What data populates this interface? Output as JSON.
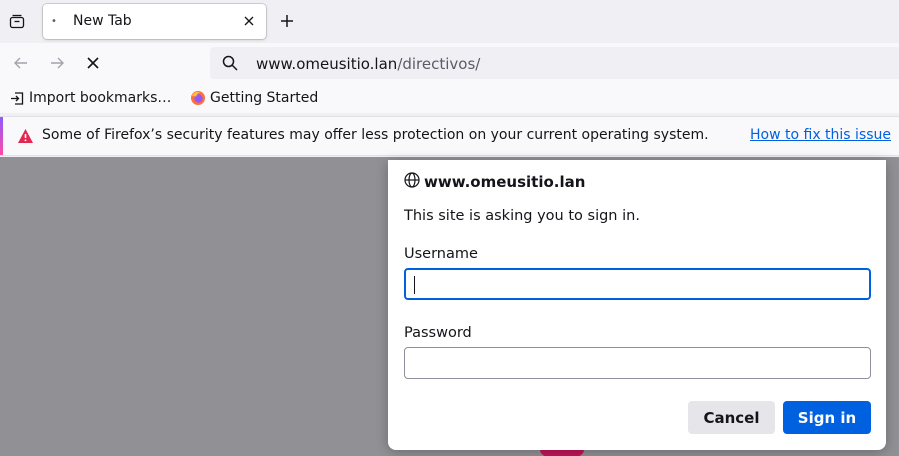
{
  "tabs": [
    {
      "title": "New Tab",
      "active": true
    }
  ],
  "toolbar": {
    "url_host": "www.omeusitio.lan",
    "url_path": "/directivos/"
  },
  "bookmarks": [
    {
      "label": "Import bookmarks…",
      "icon": "import-icon"
    },
    {
      "label": "Getting Started",
      "icon": "firefox-icon"
    }
  ],
  "notification": {
    "message": "Some of Firefox’s security features may offer less protection on your current operating system.",
    "link": "How to fix this issue",
    "icon": "warning-icon"
  },
  "auth_dialog": {
    "site": "www.omeusitio.lan",
    "message": "This site is asking you to sign in.",
    "username_label": "Username",
    "username_value": "",
    "password_label": "Password",
    "password_value": "",
    "cancel_label": "Cancel",
    "signin_label": "Sign in"
  },
  "colors": {
    "accent": "#0061e0",
    "warning": "#e22850",
    "content_bg": "#919094"
  }
}
